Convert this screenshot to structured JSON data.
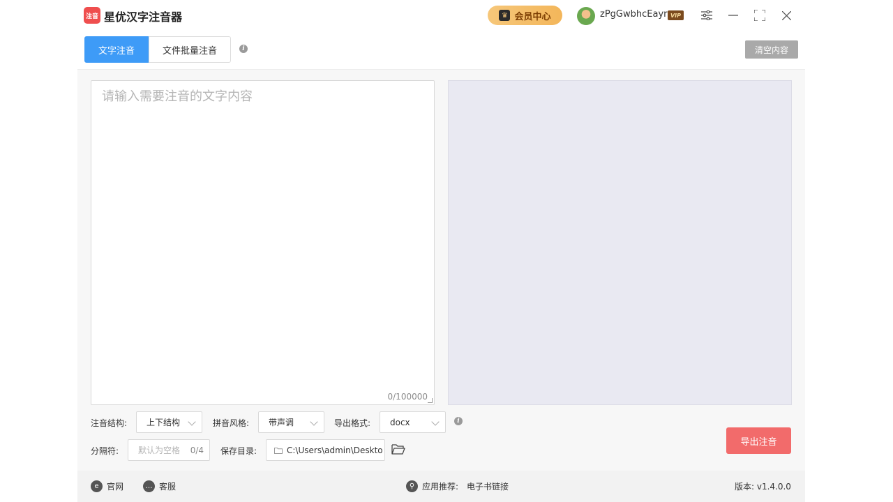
{
  "app": {
    "title": "星优汉字注音器",
    "logo_text": "注音"
  },
  "header": {
    "vip_label": "会员中心",
    "username": "zPgGwbhcEayr",
    "vip_badge": "VIP"
  },
  "tabs": [
    {
      "label": "文字注音",
      "active": true
    },
    {
      "label": "文件批量注音",
      "active": false
    }
  ],
  "toolbar": {
    "clear_label": "清空内容"
  },
  "editor": {
    "placeholder": "请输入需要注音的文字内容",
    "counter": "0/100000"
  },
  "options": {
    "structure_label": "注音结构:",
    "structure_value": "上下结构",
    "style_label": "拼音风格:",
    "style_value": "带声调",
    "format_label": "导出格式:",
    "format_value": "docx",
    "separator_label": "分隔符:",
    "separator_placeholder": "默认为空格",
    "separator_counter": "0/4",
    "save_dir_label": "保存目录:",
    "save_dir_value": "C:\\Users\\admin\\Deskto"
  },
  "export_label": "导出注音",
  "footer": {
    "website_label": "官网",
    "service_label": "客服",
    "recommend_label": "应用推荐:",
    "recommend_link": "电子书链接",
    "version": "版本: v1.4.0.0"
  },
  "colors": {
    "accent": "#3e9bf7",
    "export": "#f26b6b",
    "vip": "#f3b65a"
  }
}
